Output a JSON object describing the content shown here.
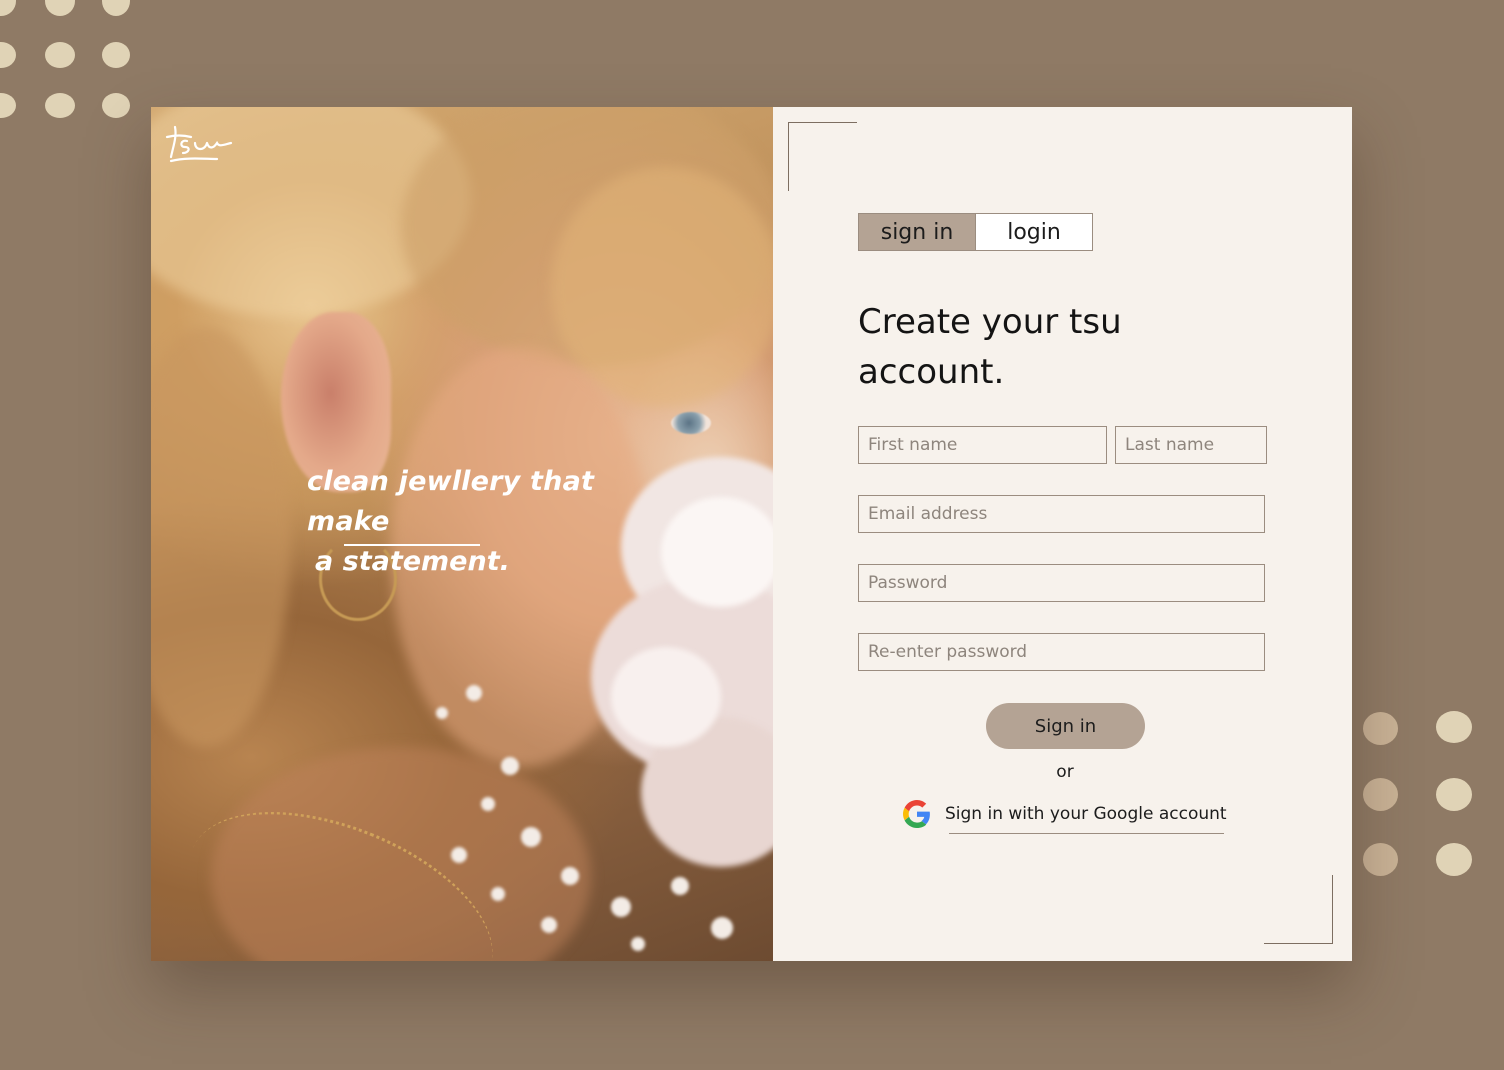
{
  "brand": {
    "logo_text": "tsu",
    "tagline_line1": "clean jewllery that make",
    "tagline_line2": "a statement."
  },
  "tabs": [
    {
      "label": "sign in",
      "active": true
    },
    {
      "label": "login",
      "active": false
    }
  ],
  "form": {
    "heading_line1": "Create your tsu",
    "heading_line2": "account.",
    "first_name_placeholder": "First name",
    "last_name_placeholder": "Last name",
    "email_placeholder": "Email address",
    "password_placeholder": "Password",
    "reenter_password_placeholder": "Re-enter password",
    "submit_label": "Sign in",
    "or_label": "or",
    "google_label": "Sign in with your Google account"
  },
  "colors": {
    "background": "#8f7a65",
    "panel": "#f7f2ec",
    "accent": "#b4a394",
    "dot_light": "#e0d3b6",
    "dot_tan": "#c9b296"
  }
}
